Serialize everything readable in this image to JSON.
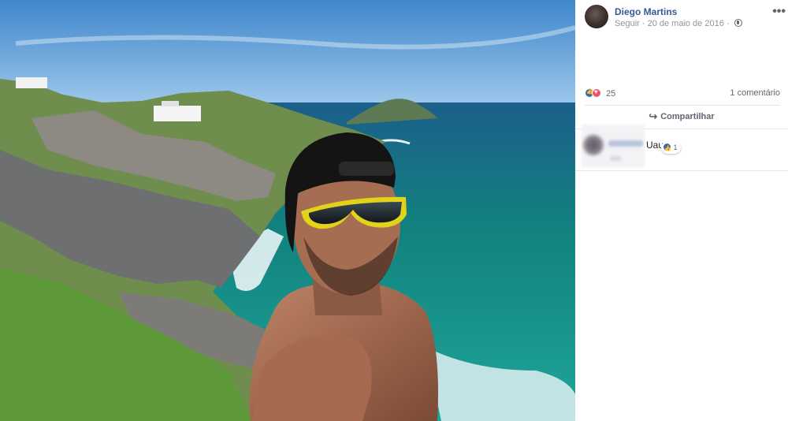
{
  "post": {
    "author": "Diego Martins",
    "follow_label": "Seguir",
    "separator": " · ",
    "date": "20 de maio de 2016",
    "separator2": " · ",
    "more_label": "•••",
    "privacy_icon": "globe-icon"
  },
  "reactions": {
    "count": "25",
    "comments_label": "1 comentário",
    "icons": [
      "like-icon",
      "love-icon"
    ],
    "colors": {
      "like": "#4267b2",
      "love": "#f25268"
    }
  },
  "actions": {
    "share_label": "Compartilhar",
    "share_icon": "share-arrow-icon"
  },
  "comment": {
    "text": "Uau",
    "reaction_count": "1"
  },
  "colors": {
    "link_blue": "#365899",
    "meta_gray": "#90949c",
    "divider": "#e5e5e5"
  }
}
